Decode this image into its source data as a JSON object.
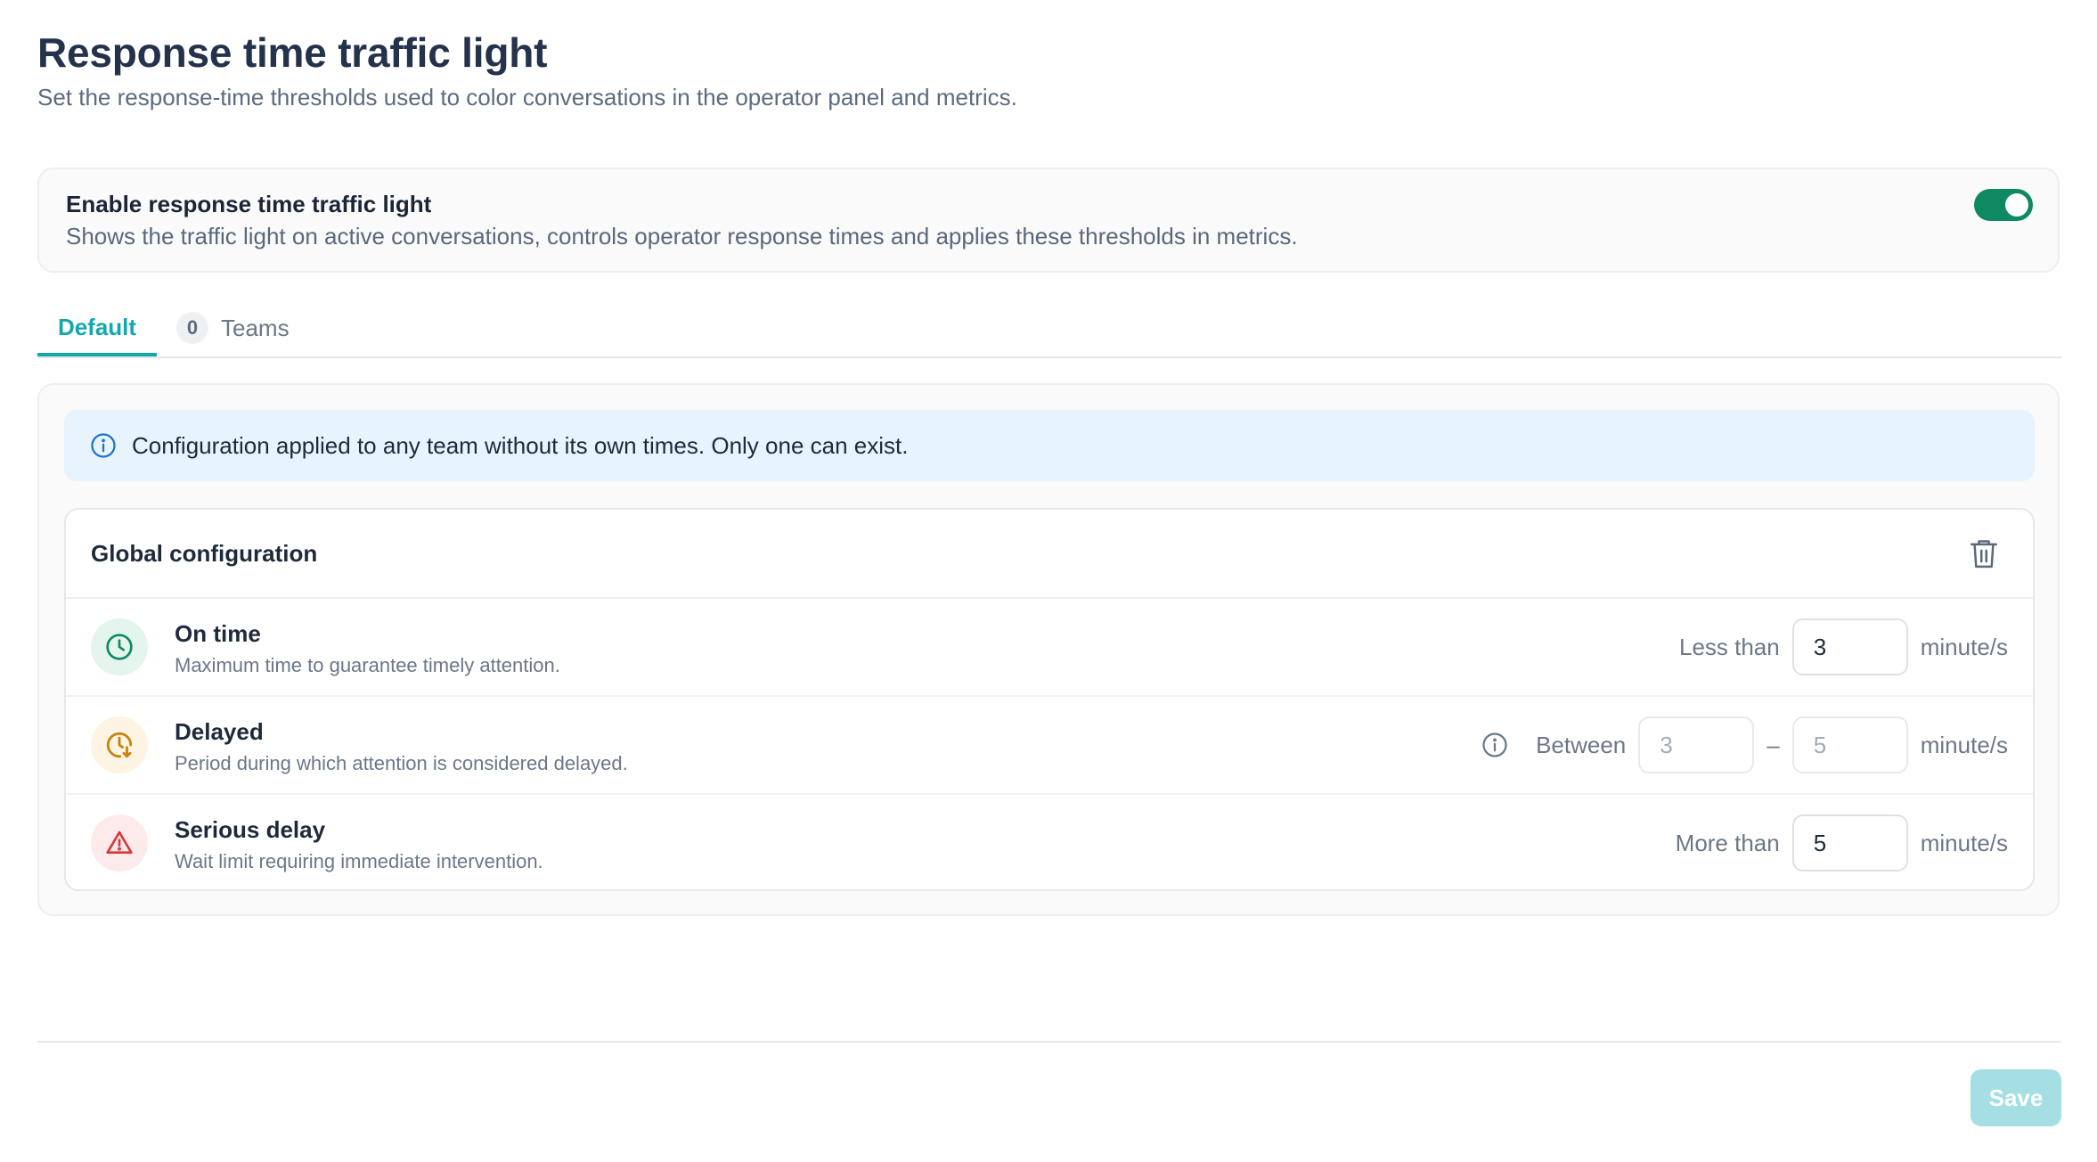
{
  "header": {
    "title": "Response time traffic light",
    "subtitle": "Set the response-time thresholds used to color conversations in the operator panel and metrics."
  },
  "enable": {
    "title": "Enable response time traffic light",
    "description": "Shows the traffic light on active conversations, controls operator response times and applies these thresholds in metrics.",
    "enabled": true,
    "toggle_color": "#0e8a63"
  },
  "tabs": [
    {
      "label": "Default",
      "active": true
    },
    {
      "label": "Teams",
      "count": "0",
      "active": false
    }
  ],
  "info": {
    "icon": "info-circle-icon",
    "text": "Configuration applied to any team without its own times. Only one can exist."
  },
  "config": {
    "title": "Global configuration",
    "rows": [
      {
        "icon": "clock-icon",
        "title": "On time",
        "description": "Maximum time to guarantee timely attention.",
        "label": "Less than",
        "value": "3",
        "unit": "minute/s",
        "color": "#0e8a63"
      },
      {
        "icon": "clock-delay-icon",
        "title": "Delayed",
        "description": "Period during which attention is considered delayed.",
        "label": "Between",
        "value_from": "3",
        "separator": "–",
        "value_to": "5",
        "unit": "minute/s",
        "color": "#c9820d"
      },
      {
        "icon": "warning-triangle-icon",
        "title": "Serious delay",
        "description": "Wait limit requiring immediate intervention.",
        "label": "More than",
        "value": "5",
        "unit": "minute/s",
        "color": "#d9373a"
      }
    ]
  },
  "footer": {
    "save_label": "Save"
  }
}
